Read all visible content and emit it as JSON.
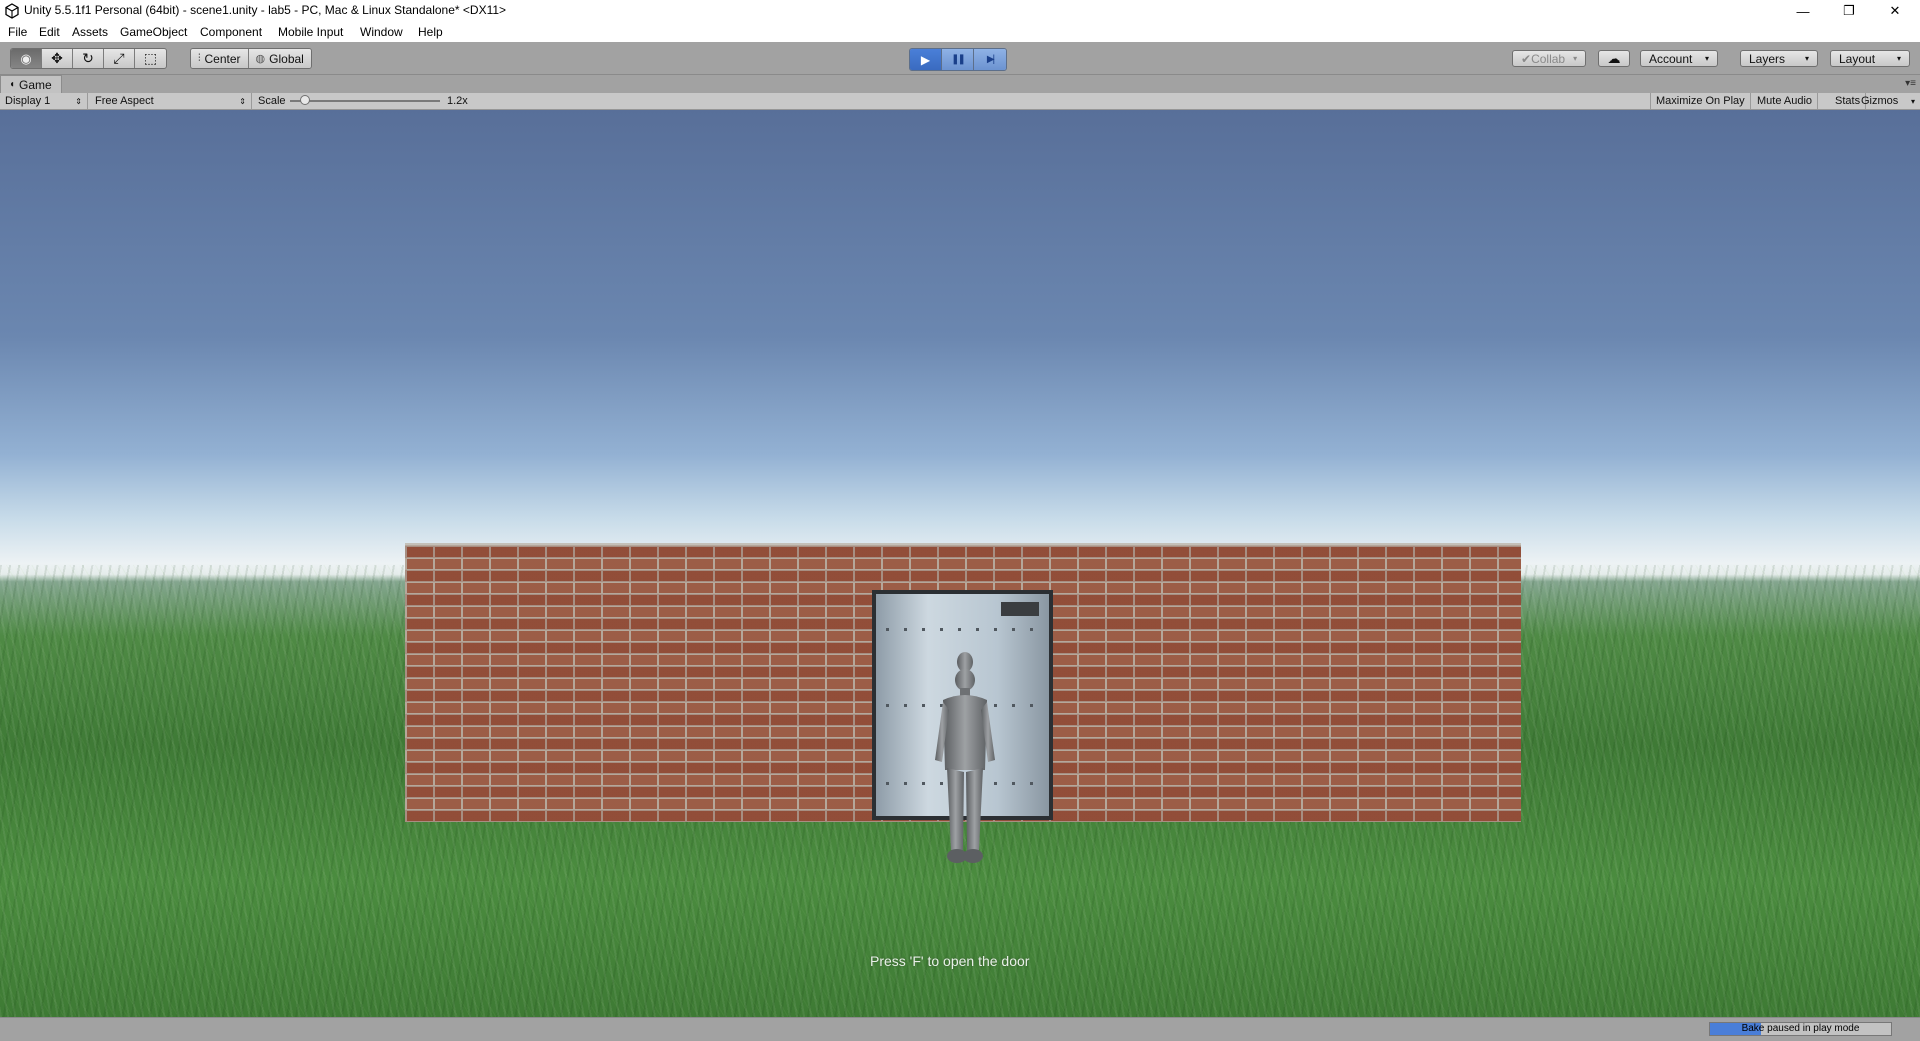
{
  "window": {
    "title": "Unity 5.5.1f1 Personal (64bit) - scene1.unity - lab5 - PC, Mac & Linux Standalone* <DX11>",
    "minimize_glyph": "—",
    "restore_glyph": "❐",
    "close_glyph": "✕"
  },
  "menu": [
    "File",
    "Edit",
    "Assets",
    "GameObject",
    "Component",
    "Mobile Input",
    "Window",
    "Help"
  ],
  "toolbar": {
    "tools": [
      {
        "name": "view-tool-icon",
        "glyph": "◉"
      },
      {
        "name": "move-tool-icon",
        "glyph": "✥"
      },
      {
        "name": "rotate-tool-icon",
        "glyph": "↻"
      },
      {
        "name": "scale-tool-icon",
        "glyph": "⤢"
      },
      {
        "name": "rect-tool-icon",
        "glyph": "⬚"
      }
    ],
    "pivot_label": "Center",
    "pivot_glyph": "⫶",
    "space_label": "Global",
    "space_glyph": "◍",
    "play_glyph": "▶",
    "pause_glyph": "❚❚",
    "step_glyph": "▶|",
    "collab_label": "Collab",
    "collab_glyph": "✔",
    "cloud_glyph": "☁",
    "account_label": "Account",
    "layers_label": "Layers",
    "layout_label": "Layout",
    "caret": "▾"
  },
  "game_view": {
    "tab_label": "Game",
    "tab_glyph": "◖",
    "tab_menu_glyph": "▾≡",
    "display_label": "Display 1",
    "aspect_label": "Free Aspect",
    "scale_label": "Scale",
    "scale_value": "1.2x",
    "maximize_label": "Maximize On Play",
    "mute_label": "Mute Audio",
    "stats_label": "Stats",
    "gizmos_label": "Gizmos",
    "hint_text": "Press 'F' to open the door"
  },
  "status": {
    "bake_label": "Bake paused in play mode",
    "bake_progress": 0.28
  },
  "colors": {
    "play_active": "#4a7fd8",
    "sky_top": "#586f99",
    "grass": "#4f8a45",
    "brick": "#9a5a45"
  }
}
